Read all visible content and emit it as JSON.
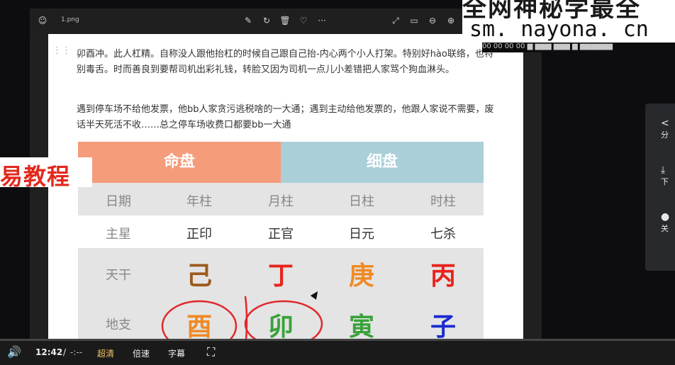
{
  "watermark": {
    "line1": "全网神秘学最全",
    "url": "sm. nayona. cn",
    "strip": "00 00 00 00 ▆ ▆▆▆ ▆▆▆ ▆ ▆▆▆▆▆▆"
  },
  "side_label": "易教程",
  "viewer": {
    "filename": "1.png",
    "icons": [
      "smile-icon",
      "edit-icon",
      "rotate-icon",
      "delete-icon",
      "heart-icon",
      "more-icon",
      "expand-icon",
      "fit-icon",
      "zoom-out-icon",
      "zoom-in-icon"
    ],
    "more_glyph": "···"
  },
  "document": {
    "paragraph1": "卯酉冲。此人杠精。自称没人跟他抬杠的时候自己跟自己抬-内心两个小人打架。特别好hào联络，也特别毒舌。时而善良到要帮司机出彩礼钱，转脸又因为司机一点儿小差错把人家骂个狗血淋头。",
    "paragraph2": "遇到停车场不给他发票，他bb人家贪污逃税啥的一大通；遇到主动给他发票的，他跟人家说不需要，废话半天死活不收……总之停车场收费口都要bb一大通"
  },
  "chart": {
    "header_left": "命盘",
    "header_right": "细盘",
    "row_date": [
      "日期",
      "年柱",
      "月柱",
      "日柱",
      "时柱"
    ],
    "row_star": [
      "主星",
      "正印",
      "正官",
      "日元",
      "七杀"
    ],
    "row_gan": {
      "label": "天干",
      "chars": [
        "己",
        "丁",
        "庚",
        "丙"
      ],
      "colors": [
        "#9c5a1c",
        "#e8231c",
        "#f08a24",
        "#e8231c"
      ]
    },
    "row_zhi": {
      "label": "地支",
      "chars": [
        "酉",
        "卯",
        "寅",
        "子"
      ],
      "colors": [
        "#f08a24",
        "#3aa13a",
        "#3aa13a",
        "#1a2bd1"
      ]
    },
    "annotation_color": "#e0282a"
  },
  "side_panel": {
    "share": "分",
    "download": "下",
    "close": "关"
  },
  "player": {
    "time": "12:42",
    "separator": "/",
    "duration": "-:--",
    "quality": "超清",
    "speed": "倍速",
    "subtitle": "字幕",
    "quality_color": "#f0c36b"
  }
}
